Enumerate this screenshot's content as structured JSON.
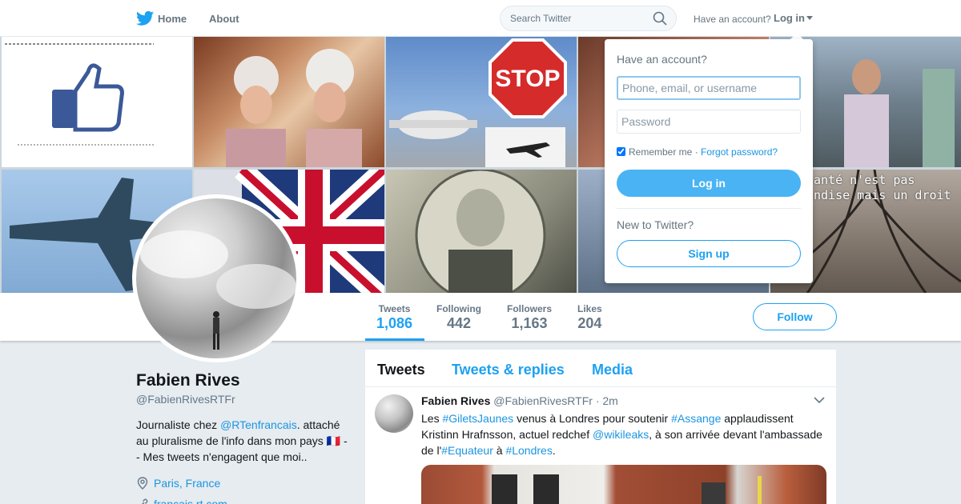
{
  "nav": {
    "home_label": "Home",
    "about_label": "About",
    "search_placeholder": "Search Twitter",
    "have_account": "Have an account?",
    "login_label": "Log in"
  },
  "banner": {
    "caption_line1": "anté n'est pas",
    "caption_line2": "ndise mais un droit"
  },
  "profile": {
    "name": "Fabien Rives",
    "handle": "@FabienRivesRTFr",
    "bio_prefix": "Journaliste chez ",
    "bio_mention": "@RTenfrancais",
    "bio_rest": ". attaché au pluralisme de l'info dans mon pays 🇫🇷 -- Mes tweets n'engagent que moi..",
    "location": "Paris, France",
    "website": "francais.rt.com"
  },
  "stats": [
    {
      "label": "Tweets",
      "value": "1,086"
    },
    {
      "label": "Following",
      "value": "442"
    },
    {
      "label": "Followers",
      "value": "1,163"
    },
    {
      "label": "Likes",
      "value": "204"
    }
  ],
  "follow_label": "Follow",
  "tabs": [
    "Tweets",
    "Tweets & replies",
    "Media"
  ],
  "tweet": {
    "name": "Fabien Rives",
    "handle": "@FabienRivesRTFr",
    "time": "2m",
    "t1": "Les ",
    "h1": "#GiletsJaunes",
    "t2": " venus à Londres pour soutenir ",
    "h2": "#Assange",
    "t3": " applaudissent Kristinn Hrafnsson, actuel redchef ",
    "h3": "@wikileaks",
    "t4": ", à son arrivée devant l'ambassade de l'",
    "h4": "#Equateur",
    "t5": " à ",
    "h5": "#Londres",
    "t6": "."
  },
  "login_dropdown": {
    "title": "Have an account?",
    "username_placeholder": "Phone, email, or username",
    "password_placeholder": "Password",
    "remember": "Remember me",
    "separator": " · ",
    "forgot": "Forgot password?",
    "login_button": "Log in",
    "new_to": "New to Twitter?",
    "signup_button": "Sign up"
  },
  "colors": {
    "accent": "#1da1f2",
    "link": "#1b95e0",
    "login_button": "#4ab3f4"
  }
}
